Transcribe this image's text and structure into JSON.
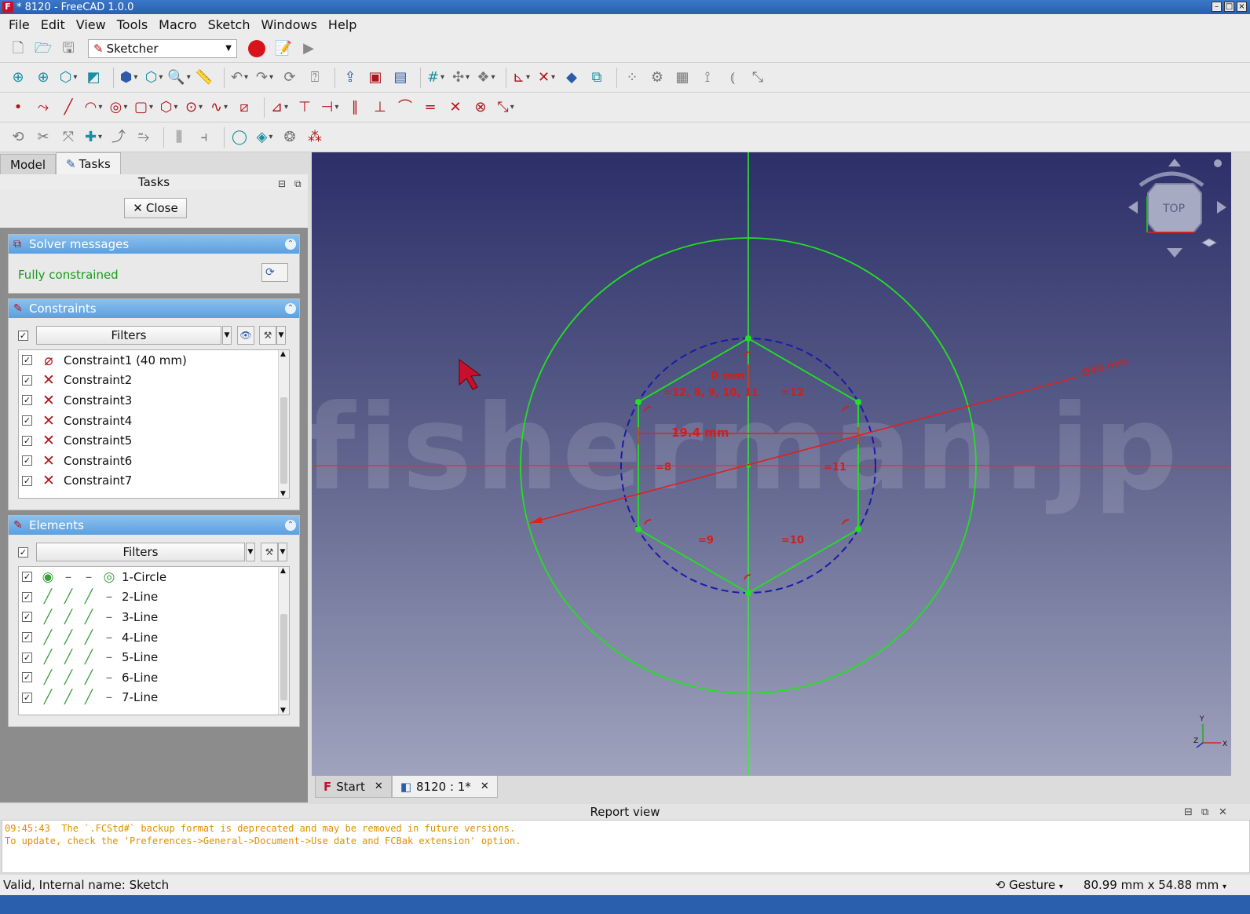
{
  "window": {
    "title": "* 8120 - FreeCAD 1.0.0"
  },
  "menu": [
    "File",
    "Edit",
    "View",
    "Tools",
    "Macro",
    "Sketch",
    "Windows",
    "Help"
  ],
  "toolbar": {
    "workbench": "Sketcher"
  },
  "left_tabs": [
    "Model",
    "Tasks"
  ],
  "tasks": {
    "header": "Tasks",
    "close_label": "Close",
    "solver": {
      "title": "Solver messages",
      "status": "Fully constrained"
    },
    "constraints": {
      "title": "Constraints",
      "filters_label": "Filters",
      "items": [
        "Constraint1 (40 mm)",
        "Constraint2",
        "Constraint3",
        "Constraint4",
        "Constraint5",
        "Constraint6",
        "Constraint7"
      ]
    },
    "elements": {
      "title": "Elements",
      "filters_label": "Filters",
      "items": [
        "1-Circle",
        "2-Line",
        "3-Line",
        "4-Line",
        "5-Line",
        "6-Line",
        "7-Line"
      ]
    }
  },
  "view": {
    "navcube_face": "TOP",
    "dims": {
      "diameter": "Ø40 mm",
      "zero": "0 mm",
      "width": "19.4 mm",
      "eq_top_left": "=12, 8, 9, 10, 11",
      "eq_top_right": "=12",
      "eq_left": "=8",
      "eq_right": "=11",
      "eq_bottom_left": "=9",
      "eq_bottom_right": "=10"
    },
    "axis_labels": {
      "y": "Y",
      "x": "X",
      "z": "Z"
    },
    "watermark": "© fisherman.jp"
  },
  "doc_tabs": [
    "Start",
    "8120 : 1*"
  ],
  "report": {
    "title": "Report view",
    "lines": [
      "09:45:43  The `.FCStd#` backup format is deprecated and may be removed in future versions.",
      "To update, check the 'Preferences->General->Document->Use date and FCBak extension' option."
    ]
  },
  "status": {
    "left": "Valid, Internal name: Sketch",
    "nav_style": "Gesture",
    "dimensions": "80.99 mm x 54.88 mm"
  },
  "colors": {
    "constraint_red": "#d0201a",
    "geometry_green": "#22dd22",
    "construction_blue": "#1a1aaa"
  }
}
